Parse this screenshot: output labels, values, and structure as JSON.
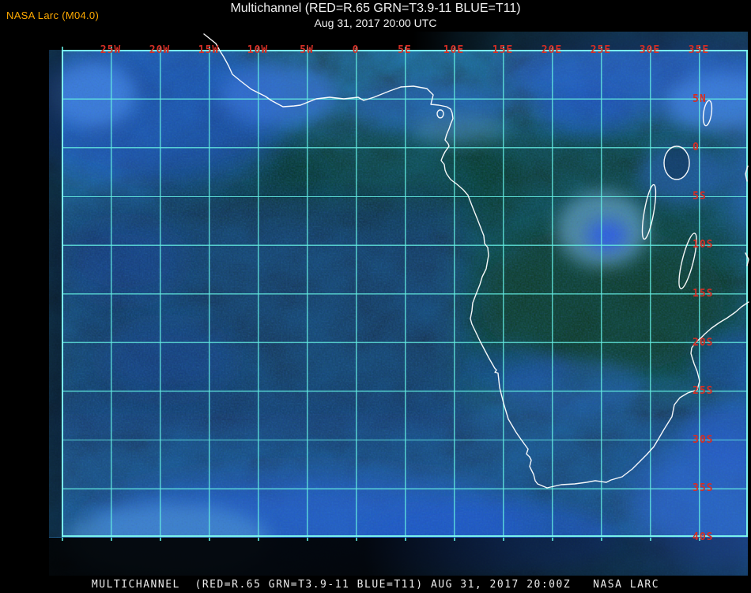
{
  "header": {
    "credit": "NASA Larc (M04.0)",
    "title": "Multichannel (RED=R.65 GRN=T3.9-11 BLUE=T11)",
    "subtitle": "Aug 31, 2017 20:00 UTC"
  },
  "map": {
    "region": "Africa",
    "longitude_labels": [
      "25W",
      "20W",
      "15W",
      "10W",
      "5W",
      "0",
      "5E",
      "10E",
      "15E",
      "20E",
      "25E",
      "30E",
      "35E"
    ],
    "latitude_labels": [
      "5N",
      "0",
      "5S",
      "10S",
      "15S",
      "20S",
      "25S",
      "30S",
      "35S",
      "40S"
    ],
    "grid_color": "#64eee2",
    "label_color": "#d42e25",
    "coast_color": "#ffffff"
  },
  "footer": {
    "caption": "MULTICHANNEL  (RED=R.65 GRN=T3.9-11 BLUE=T11) AUG 31, 2017 20:00Z   NASA LARC"
  },
  "colors": {
    "page_background": "#000000",
    "credit_text": "#ffaa00",
    "title_text": "#f0f0f0",
    "land_dark_green": "#062b0d",
    "ocean_dark_navy": "#0d2750",
    "cloud_bright_blue": "#3f7ce0",
    "cloud_cyan": "#79b8dc"
  }
}
